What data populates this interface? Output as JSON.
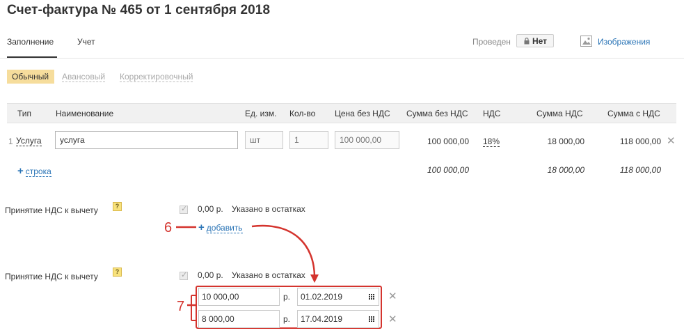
{
  "page_title": "Счет-фактура № 465 от 1 сентября 2018",
  "tabs": [
    {
      "label": "Заполнение",
      "active": true
    },
    {
      "label": "Учет",
      "active": false
    }
  ],
  "status": {
    "label": "Проведен",
    "value": "Нет",
    "icon": "lock-icon"
  },
  "images_link": {
    "label": "Изображения",
    "icon": "image-icon"
  },
  "invoice_types": [
    {
      "label": "Обычный",
      "active": true
    },
    {
      "label": "Авансовый",
      "active": false
    },
    {
      "label": "Корректировочный",
      "active": false
    }
  ],
  "table": {
    "headers": {
      "type": "Тип",
      "name": "Наименование",
      "unit": "Ед. изм.",
      "qty": "Кол-во",
      "price": "Цена без НДС",
      "sum_no_vat": "Сумма без НДС",
      "vat": "НДС",
      "vat_sum": "Сумма НДС",
      "sum_with_vat": "Сумма с НДС"
    },
    "rows": [
      {
        "num": "1",
        "type": "Услуга",
        "name": "услуга",
        "unit_placeholder": "шт",
        "qty_placeholder": "1",
        "price_placeholder": "100 000,00",
        "sum_no_vat": "100 000,00",
        "vat_rate": "18%",
        "vat_sum": "18 000,00",
        "sum_with_vat": "118 000,00"
      }
    ],
    "add_row_label": "строка",
    "totals": {
      "sum_no_vat": "100 000,00",
      "vat_sum": "18 000,00",
      "sum_with_vat": "118 000,00"
    }
  },
  "vat_deduction_1": {
    "label": "Принятие НДС к вычету",
    "help": "?",
    "checked": true,
    "amount": "0,00 р.",
    "note": "Указано в остатках",
    "add_label": "добавить"
  },
  "vat_deduction_2": {
    "label": "Принятие НДС к вычету",
    "help": "?",
    "checked": true,
    "amount": "0,00 р.",
    "note": "Указано в остатках",
    "entries": [
      {
        "amount": "10 000,00",
        "currency": "р.",
        "date": "01.02.2019"
      },
      {
        "amount": "8 000,00",
        "currency": "р.",
        "date": "17.04.2019"
      }
    ]
  },
  "annotations": {
    "step_6": "6",
    "step_7": "7"
  },
  "colors": {
    "accent_link": "#2a74b6",
    "annotation_red": "#d4342e",
    "active_segment": "#f6dd9c"
  }
}
